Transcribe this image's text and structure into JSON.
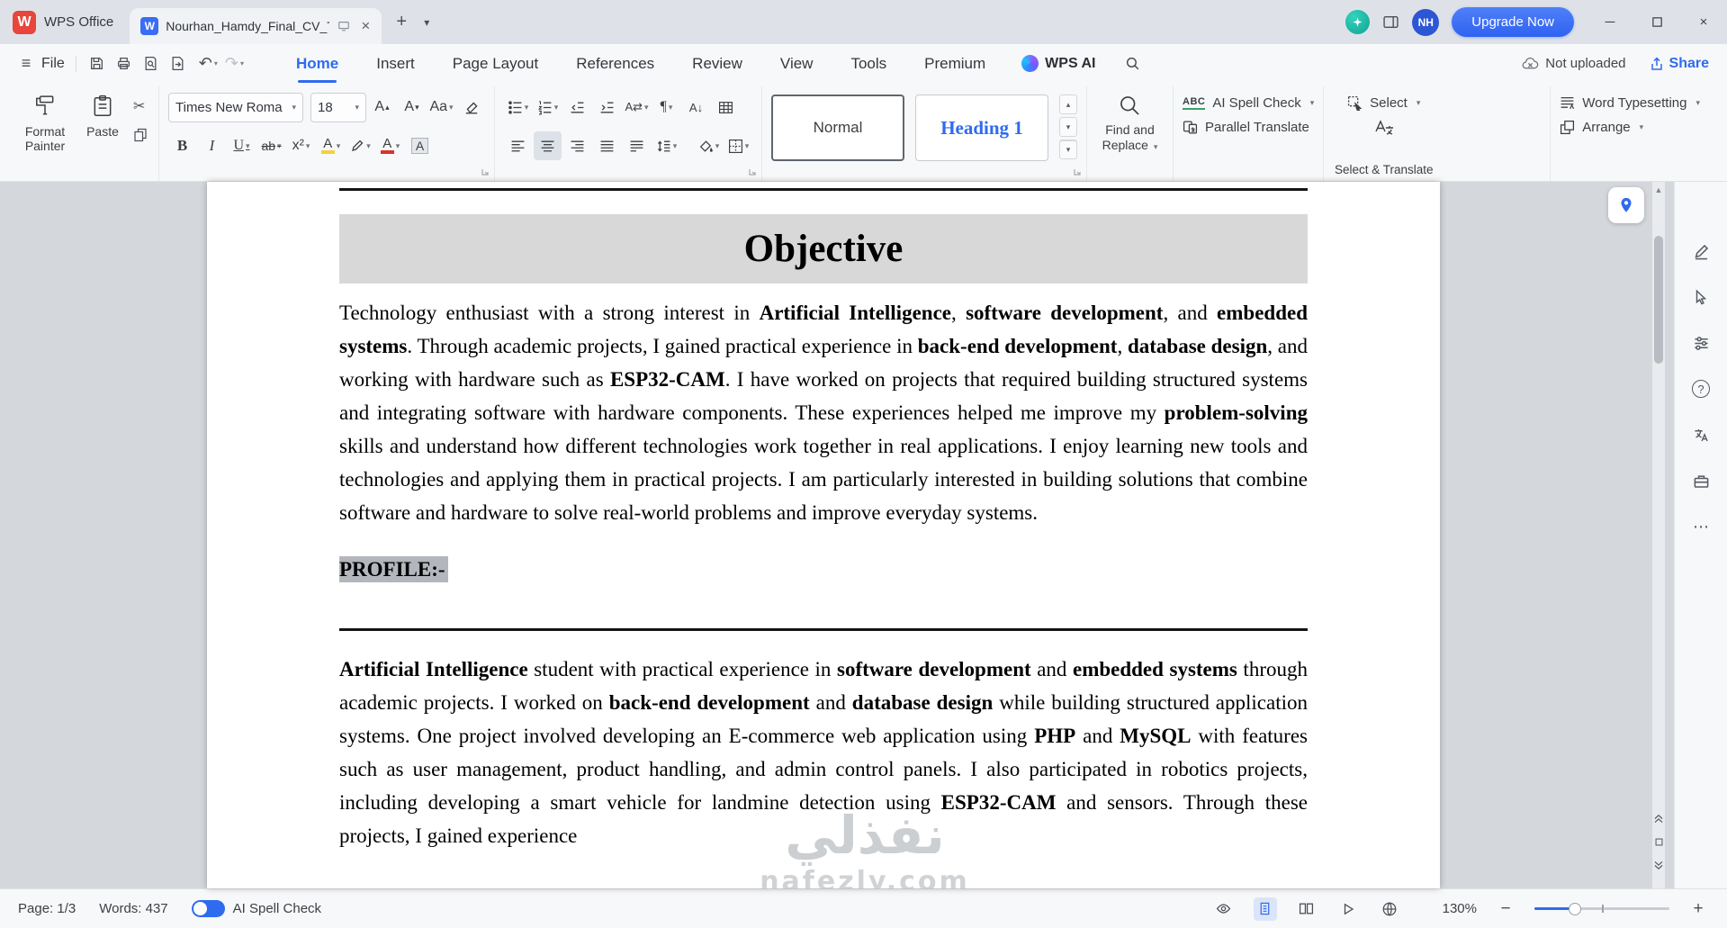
{
  "titlebar": {
    "app_name": "WPS Office",
    "doc_title": "Nourhan_Hamdy_Final_CV_Te",
    "upgrade_label": "Upgrade Now",
    "avatar_initials": "NH"
  },
  "menubar": {
    "file_label": "File",
    "tabs": [
      {
        "label": "Home"
      },
      {
        "label": "Insert"
      },
      {
        "label": "Page Layout"
      },
      {
        "label": "References"
      },
      {
        "label": "Review"
      },
      {
        "label": "View"
      },
      {
        "label": "Tools"
      },
      {
        "label": "Premium"
      }
    ],
    "wps_ai": "WPS AI",
    "not_uploaded": "Not uploaded",
    "share": "Share"
  },
  "ribbon": {
    "format_painter_label": "Format Painter",
    "paste_label": "Paste",
    "font_name": "Times New Roman",
    "font_size": "18",
    "style_normal": "Normal",
    "style_heading1": "Heading 1",
    "find_replace_label": "Find and Replace",
    "ai_spell_check_label": "AI Spell Check",
    "parallel_translate_label": "Parallel Translate",
    "select_label": "Select",
    "select_translate_caption": "Select & Translate",
    "word_typesetting_label": "Word Typesetting",
    "arrange_label": "Arrange"
  },
  "document": {
    "heading": "Objective",
    "para1": [
      {
        "t": "Technology enthusiast with a strong interest in "
      },
      {
        "t": "Artificial Intelligence",
        "b": true
      },
      {
        "t": ", "
      },
      {
        "t": "software development",
        "b": true
      },
      {
        "t": ", and "
      },
      {
        "t": "embedded systems",
        "b": true
      },
      {
        "t": ". Through academic projects, I gained practical experience in "
      },
      {
        "t": "back-end development",
        "b": true
      },
      {
        "t": ", "
      },
      {
        "t": "database design",
        "b": true
      },
      {
        "t": ", and working with hardware such as "
      },
      {
        "t": "ESP32-CAM",
        "b": true
      },
      {
        "t": ". I have worked on projects that required building structured systems and integrating software with hardware components. These experiences helped me improve my "
      },
      {
        "t": "problem-solving",
        "b": true
      },
      {
        "t": " skills and understand how different technologies work together in real applications. I enjoy learning new tools and technologies and applying them in practical projects. I am particularly interested in building solutions that combine software and hardware to solve real-world problems and improve everyday systems."
      }
    ],
    "profile_label": "PROFILE:-",
    "para2": [
      {
        "t": "Artificial Intelligence",
        "b": true
      },
      {
        "t": " student with practical experience in "
      },
      {
        "t": "software development",
        "b": true
      },
      {
        "t": " and "
      },
      {
        "t": "embedded systems",
        "b": true
      },
      {
        "t": " through academic projects. I worked on "
      },
      {
        "t": "back-end development",
        "b": true
      },
      {
        "t": " and "
      },
      {
        "t": "database design",
        "b": true
      },
      {
        "t": " while building structured application systems. One project involved developing an E-commerce web application using "
      },
      {
        "t": "PHP",
        "b": true
      },
      {
        "t": " and "
      },
      {
        "t": "MySQL",
        "b": true
      },
      {
        "t": " with features such as user management, product handling, and admin control panels. I also participated in robotics projects, including developing a smart vehicle for landmine detection using "
      },
      {
        "t": "ESP32-CAM",
        "b": true
      },
      {
        "t": " and sensors. Through these projects, I gained experience"
      }
    ],
    "watermark_title": "نفذلي",
    "watermark_sub": "nafezly.com"
  },
  "statusbar": {
    "page": "Page: 1/3",
    "words": "Words: 437",
    "spell_label": "AI Spell Check",
    "zoom_percent": "130%"
  }
}
